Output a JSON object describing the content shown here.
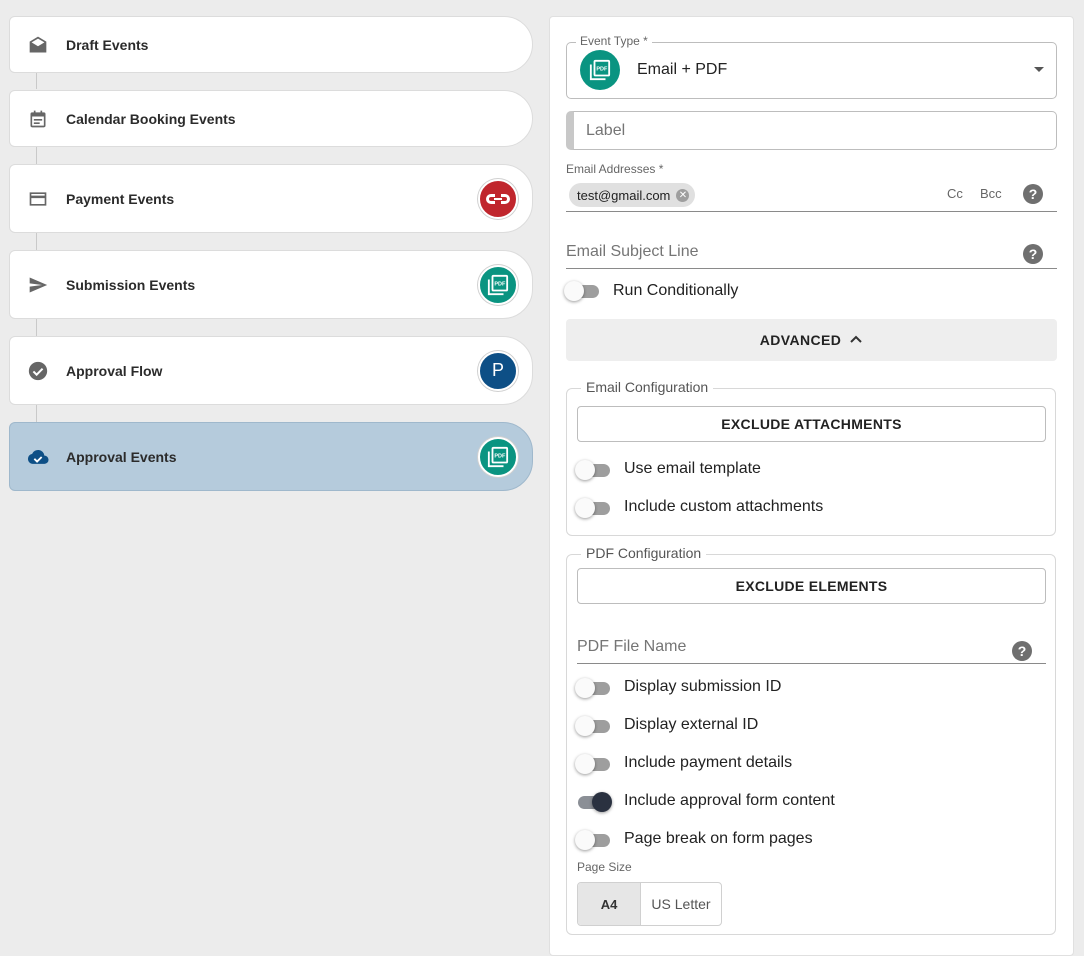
{
  "events": [
    {
      "label": "Draft Events",
      "icon": "envelope-open-icon"
    },
    {
      "label": "Calendar Booking Events",
      "icon": "calendar-icon"
    },
    {
      "label": "Payment Events",
      "icon": "credit-card-icon",
      "badge_icon": "cp-logo-icon",
      "badge_color": "#c0262d"
    },
    {
      "label": "Submission Events",
      "icon": "send-icon",
      "badge_icon": "pdf-icon",
      "badge_color": "#0a9481"
    },
    {
      "label": "Approval Flow",
      "icon": "check-circle-icon",
      "badge_text": "P",
      "badge_color": "#0d4f86"
    },
    {
      "label": "Approval Events",
      "icon": "cloud-done-icon",
      "badge_icon": "pdf-icon",
      "badge_color": "#0a9481",
      "active": true
    }
  ],
  "form": {
    "event_type_label": "Event Type *",
    "event_type_value": "Email + PDF",
    "label_placeholder": "Label",
    "email_label": "Email Addresses *",
    "email_chip": "test@gmail.com",
    "cc": "Cc",
    "bcc": "Bcc",
    "subject_placeholder": "Email Subject Line",
    "run_conditionally": "Run Conditionally",
    "advanced": "ADVANCED",
    "help": "?"
  },
  "email_config": {
    "legend": "Email Configuration",
    "exclude_attachments": "EXCLUDE ATTACHMENTS",
    "use_template": "Use email template",
    "custom_attachments": "Include custom attachments"
  },
  "pdf_config": {
    "legend": "PDF Configuration",
    "exclude_elements": "EXCLUDE ELEMENTS",
    "file_name_placeholder": "PDF File Name",
    "toggles": [
      {
        "label": "Display submission ID",
        "on": false
      },
      {
        "label": "Display external ID",
        "on": false
      },
      {
        "label": "Include payment details",
        "on": false
      },
      {
        "label": "Include approval form content",
        "on": true
      },
      {
        "label": "Page break on form pages",
        "on": false
      }
    ],
    "page_size_label": "Page Size",
    "page_size_options": [
      "A4",
      "US Letter"
    ],
    "page_size_selected": "A4"
  },
  "colors": {
    "accent_teal": "#0a9481",
    "active_bg": "#b5cbdc",
    "navy": "#0d4f86"
  }
}
